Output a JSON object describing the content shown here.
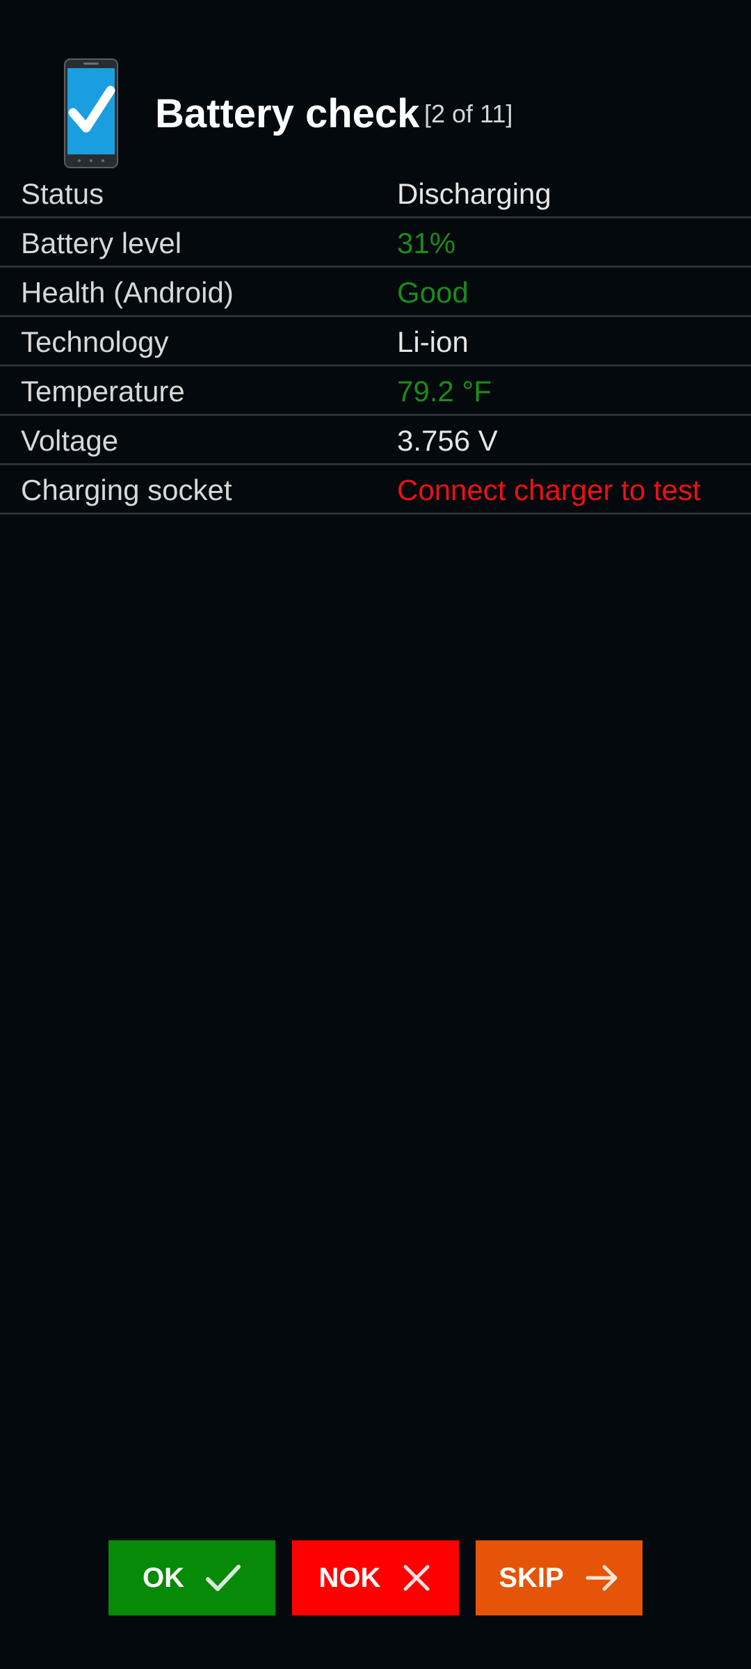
{
  "header": {
    "title": "Battery check",
    "step": "[2 of 11]",
    "icon": "phone-check-icon"
  },
  "rows": [
    {
      "label": "Status",
      "value": "Discharging",
      "status": "neutral"
    },
    {
      "label": "Battery level",
      "value": "31%",
      "status": "good"
    },
    {
      "label": "Health (Android)",
      "value": "Good",
      "status": "good"
    },
    {
      "label": "Technology",
      "value": "Li-ion",
      "status": "neutral"
    },
    {
      "label": "Temperature",
      "value": "79.2 °F",
      "status": "good"
    },
    {
      "label": "Voltage",
      "value": "3.756 V",
      "status": "neutral"
    },
    {
      "label": "Charging socket",
      "value": "Connect charger to test",
      "status": "bad"
    }
  ],
  "buttons": {
    "ok": {
      "label": "OK",
      "icon": "check-icon"
    },
    "nok": {
      "label": "NOK",
      "icon": "close-icon"
    },
    "skip": {
      "label": "SKIP",
      "icon": "arrow-right-icon"
    }
  },
  "colors": {
    "background": "#03090c",
    "good": "#1a8c1a",
    "bad": "#ee1111",
    "ok_button": "#078a07",
    "nok_button": "#ff0000",
    "skip_button": "#e55408"
  }
}
